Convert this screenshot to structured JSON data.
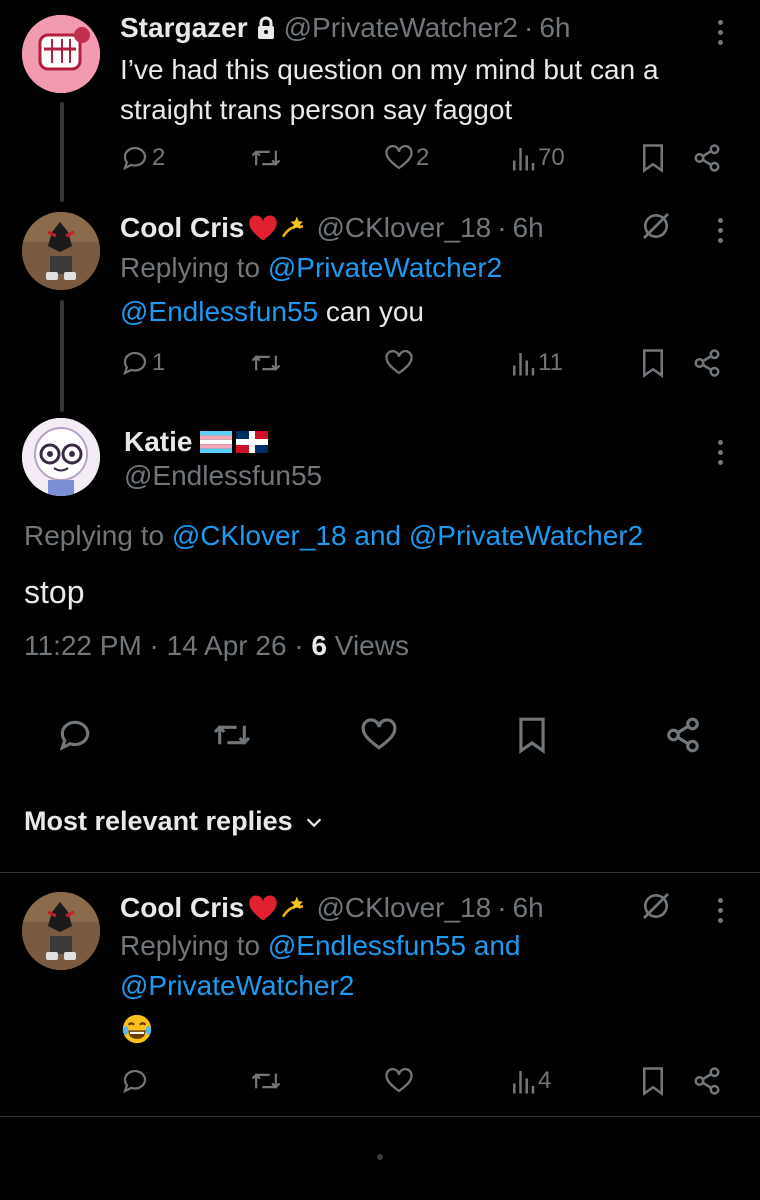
{
  "tweet1": {
    "name": "Stargazer",
    "handle": "@PrivateWatcher2",
    "dot": "·",
    "time": "6h",
    "text": "I’ve had this question on my mind but can a straight trans person say faggot",
    "replies": "2",
    "likes": "2",
    "views": "70"
  },
  "tweet2": {
    "name": "Cool Cris",
    "handle": "@CKlover_18",
    "dot": "·",
    "time": "6h",
    "replying_prefix": "Replying to ",
    "replying_to": "@PrivateWatcher2",
    "mention": "@Endlessfun55",
    "text": " can you",
    "replies": "1",
    "views": "11"
  },
  "main": {
    "name": "Katie",
    "handle": "@Endlessfun55",
    "replying_prefix": "Replying to ",
    "replying_to": "@CKlover_18 and @PrivateWatcher2",
    "text": "stop",
    "timestamp": "11:22 PM · 14 Apr 26 · ",
    "views_count": "6",
    "views_label": " Views"
  },
  "sort": {
    "label": "Most relevant replies"
  },
  "reply": {
    "name": "Cool Cris",
    "handle": "@CKlover_18",
    "dot": "·",
    "time": "6h",
    "replying_prefix": "Replying to ",
    "replying_line1": "@Endlessfun55 and",
    "replying_line2": "@PrivateWatcher2",
    "emoji_name": "tears-of-joy-emoji",
    "views": "4"
  },
  "colors": {
    "background": "#000000",
    "text": "#e7e9ea",
    "muted": "#71767b",
    "link": "#1d9bf0",
    "divider": "#2f3336"
  }
}
